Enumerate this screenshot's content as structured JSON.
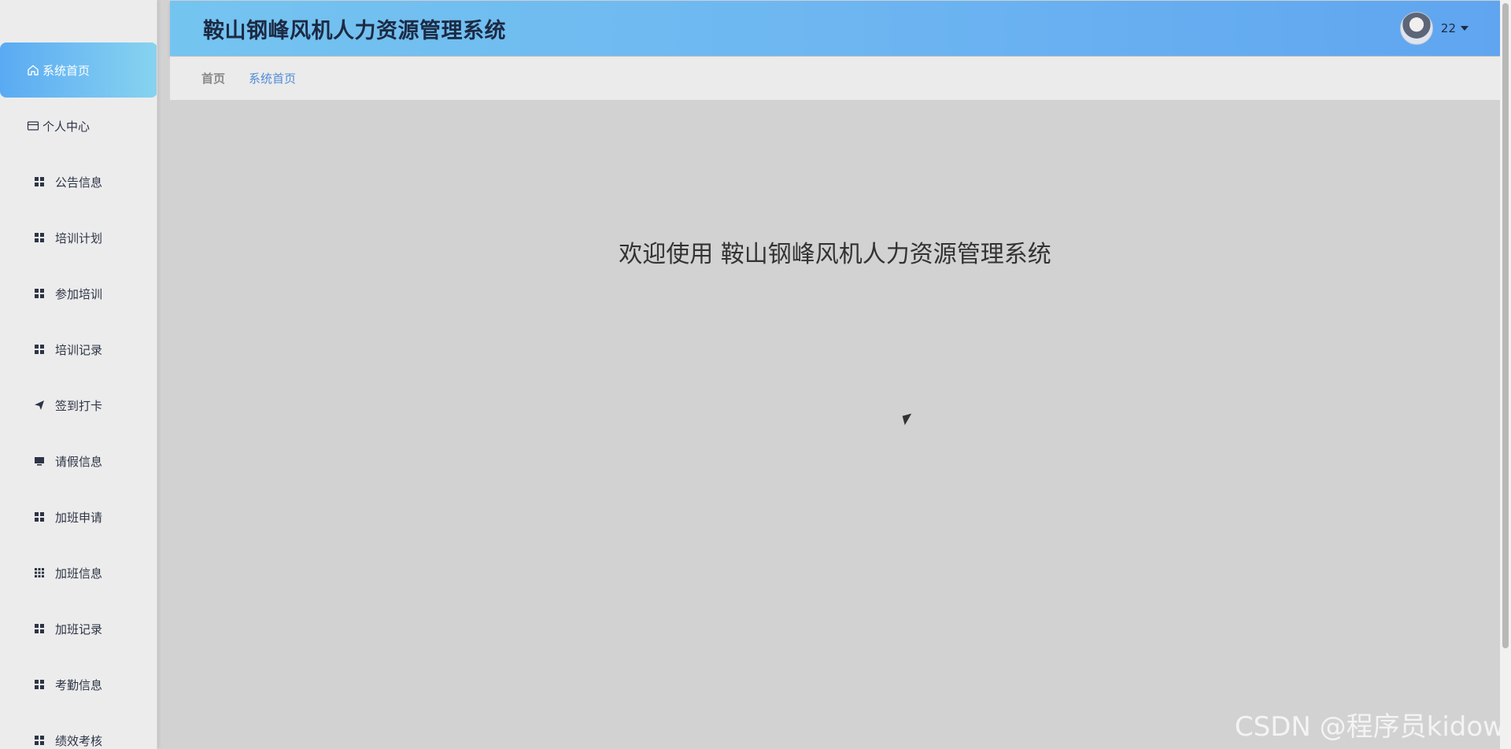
{
  "header": {
    "app_title": "鞍山钢峰风机人力资源管理系统",
    "user_name": "22"
  },
  "breadcrumb": {
    "home": "首页",
    "current": "系统首页"
  },
  "sidebar": {
    "items": [
      {
        "label": "系统首页",
        "icon": "home-icon"
      },
      {
        "label": "个人中心",
        "icon": "card-icon"
      },
      {
        "label": "公告信息",
        "icon": "grid-icon"
      },
      {
        "label": "培训计划",
        "icon": "grid-icon"
      },
      {
        "label": "参加培训",
        "icon": "grid-icon"
      },
      {
        "label": "培训记录",
        "icon": "grid-icon"
      },
      {
        "label": "签到打卡",
        "icon": "send-icon"
      },
      {
        "label": "请假信息",
        "icon": "monitor-icon"
      },
      {
        "label": "加班申请",
        "icon": "grid-icon"
      },
      {
        "label": "加班信息",
        "icon": "grid-dense-icon"
      },
      {
        "label": "加班记录",
        "icon": "grid-icon"
      },
      {
        "label": "考勤信息",
        "icon": "grid-icon"
      },
      {
        "label": "绩效考核",
        "icon": "grid-icon"
      }
    ]
  },
  "main": {
    "welcome": "欢迎使用 鞍山钢峰风机人力资源管理系统"
  },
  "watermark": "CSDN @程序员kidow",
  "colors": {
    "accent": "#5aaaf3",
    "header_start": "#74c4f0",
    "header_end": "#5fa5f0",
    "breadcrumb_link": "#4f8bd6"
  }
}
